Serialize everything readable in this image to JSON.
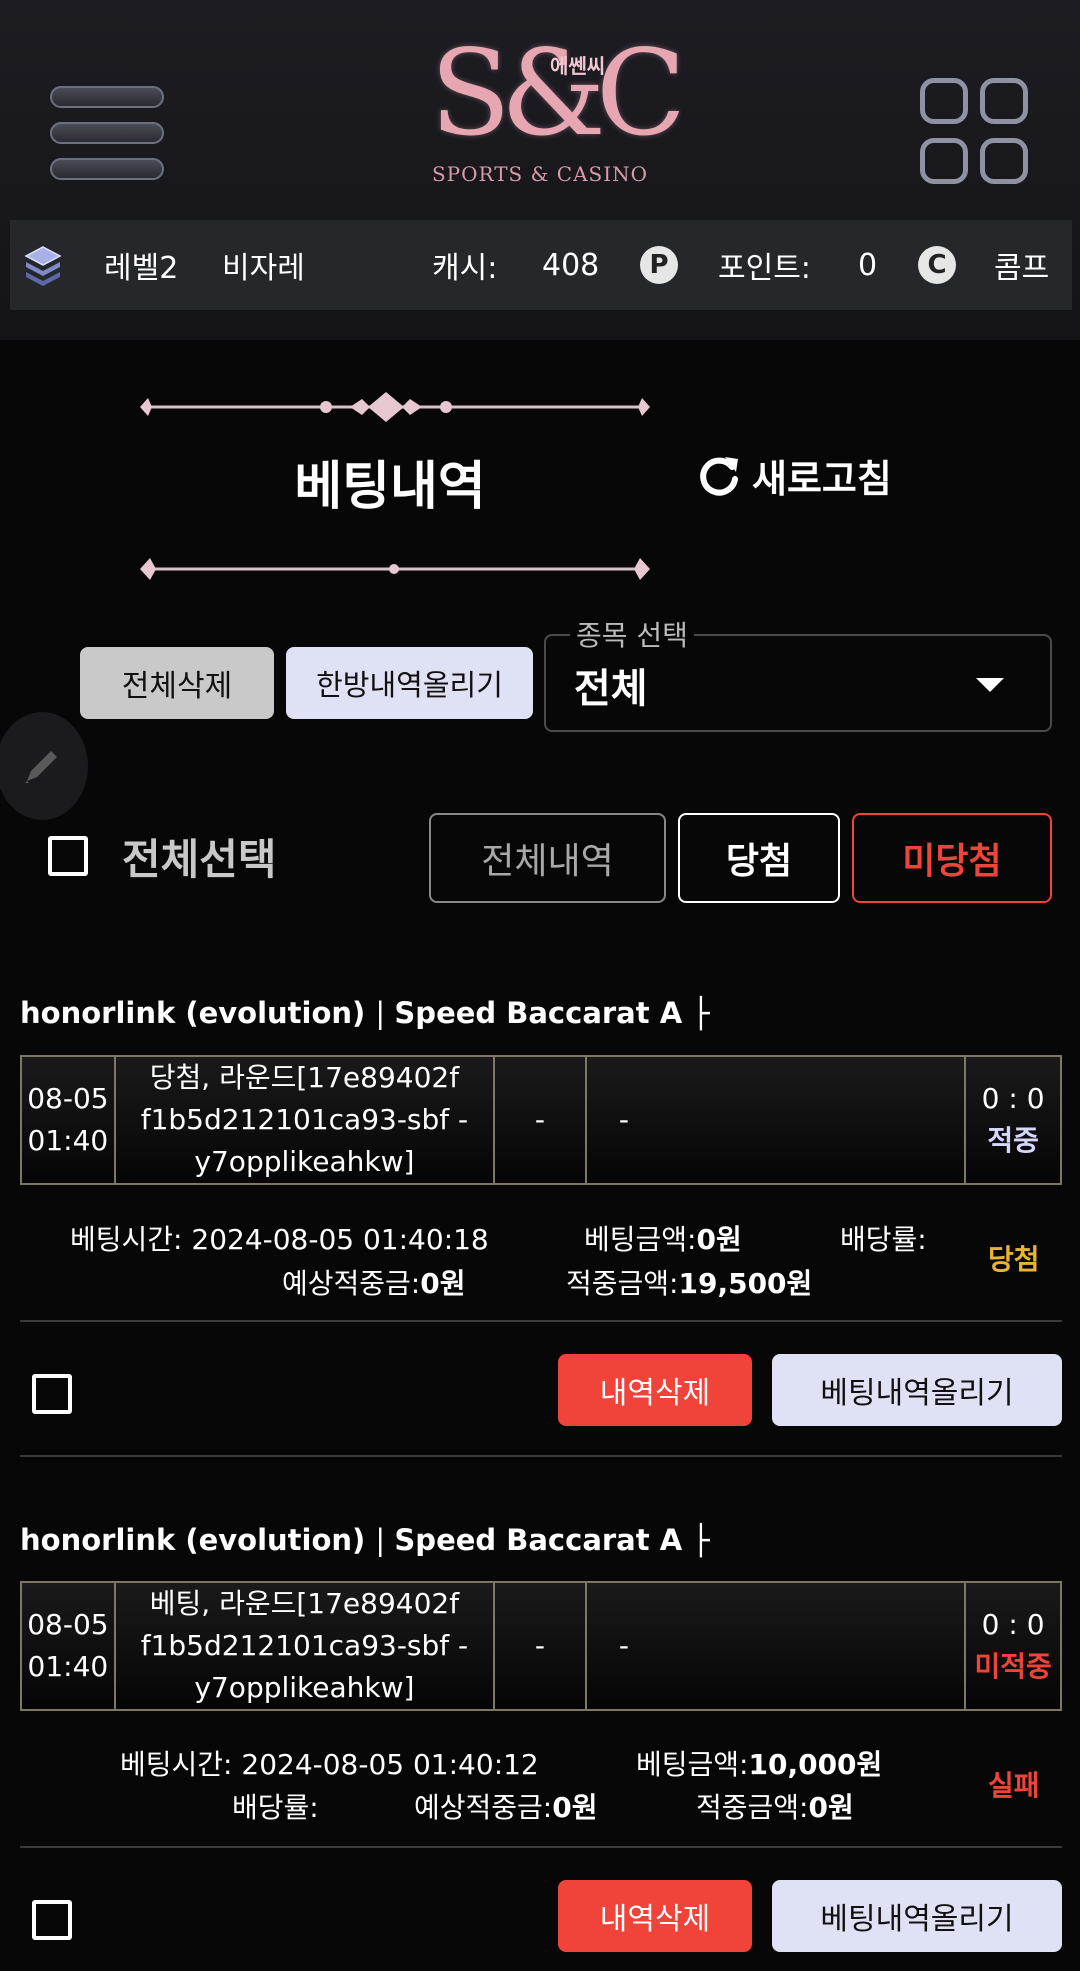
{
  "header": {
    "logo_korean": "에쎈씨",
    "logo_mark": "S&C",
    "logo_caption": "SPORTS & CASINO"
  },
  "info_bar": {
    "level": "레벨2",
    "username": "비자레",
    "cash_label": "캐시:",
    "cash_value": "408",
    "point_badge": "P",
    "point_label": "포인트:",
    "point_value": "0",
    "comp_badge": "C",
    "comp_label": "콤프"
  },
  "page": {
    "title": "베팅내역",
    "refresh_label": "새로고침"
  },
  "actions": {
    "delete_all": "전체삭제",
    "upload_all": "한방내역올리기"
  },
  "sport_select": {
    "legend": "종목 선택",
    "value": "전체"
  },
  "filters": {
    "select_all": "전체선택",
    "all": "전체내역",
    "win": "당첨",
    "lose": "미당첨"
  },
  "colors": {
    "accent_red": "#f0433a",
    "win_gold": "#e8b437",
    "hit_blue": "#d4d8ff",
    "miss_red": "#f0433a"
  },
  "bets": [
    {
      "provider": "honorlink (evolution)",
      "game": "Speed Baccarat A",
      "date": "08-05",
      "time": "01:40",
      "desc_line1": "당첨, 라운드[17e89402f",
      "desc_line2": "f1b5d212101ca93-sbf -",
      "desc_line3": "y7opplikeahkw]",
      "col3": "-",
      "col4": "-",
      "score": "0 : 0",
      "hit_status": "적중",
      "bet_time": "베팅시간: 2024-08-05 01:40:18",
      "bet_amount_label": "베팅금액:",
      "bet_amount_value": "0원",
      "odds_label": "배당률:",
      "expected_label": "예상적중금:",
      "expected_value": "0원",
      "win_amount_label": "적중금액:",
      "win_amount_value": "19,500원",
      "result": "당첨",
      "delete_label": "내역삭제",
      "upload_label": "베팅내역올리기"
    },
    {
      "provider": "honorlink (evolution)",
      "game": "Speed Baccarat A",
      "date": "08-05",
      "time": "01:40",
      "desc_line1": "베팅, 라운드[17e89402f",
      "desc_line2": "f1b5d212101ca93-sbf -",
      "desc_line3": "y7opplikeahkw]",
      "col3": "-",
      "col4": "-",
      "score": "0 : 0",
      "hit_status": "미적중",
      "bet_time": "베팅시간: 2024-08-05 01:40:12",
      "bet_amount_label": "베팅금액:",
      "bet_amount_value": "10,000원",
      "odds_label": "배당률:",
      "expected_label": "예상적중금:",
      "expected_value": "0원",
      "win_amount_label": "적중금액:",
      "win_amount_value": "0원",
      "result": "실패",
      "delete_label": "내역삭제",
      "upload_label": "베팅내역올리기"
    }
  ]
}
